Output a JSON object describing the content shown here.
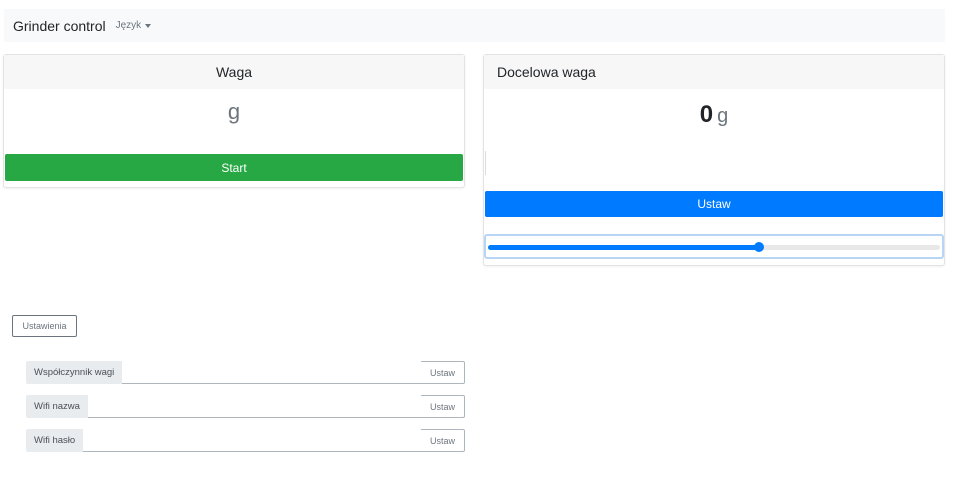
{
  "navbar": {
    "brand": "Grinder control",
    "language_label": "Język"
  },
  "weight_card": {
    "title": "Waga",
    "value": "",
    "unit": "g",
    "start_label": "Start"
  },
  "target_card": {
    "title": "Docelowa waga",
    "value": "0",
    "unit": "g",
    "input_value": "",
    "set_label": "Ustaw",
    "slider_fraction": 0.6
  },
  "settings": {
    "toggle_label": "Ustawienia",
    "rows": [
      {
        "label": "Współczynnik wagi",
        "value": "",
        "button": "Ustaw"
      },
      {
        "label": "Wifi nazwa",
        "value": "",
        "button": "Ustaw"
      },
      {
        "label": "Wifi hasło",
        "value": "",
        "button": "Ustaw"
      }
    ]
  },
  "colors": {
    "start_button": "#28a745",
    "set_button": "#007bff",
    "navbar_bg": "#f8f9fa"
  }
}
